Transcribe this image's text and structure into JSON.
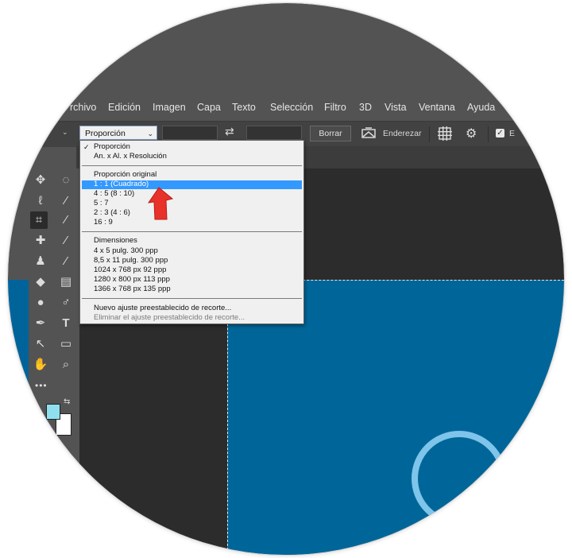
{
  "menu": {
    "items": [
      "rchivo",
      "Edición",
      "Imagen",
      "Capa",
      "Texto",
      "Selección",
      "Filtro",
      "3D",
      "Vista",
      "Ventana",
      "Ayuda"
    ]
  },
  "options_bar": {
    "ratio_select_value": "Proporción",
    "swap_icon": "swap-arrows-icon",
    "clear_button": "Borrar",
    "straighten_label": "Enderezar",
    "overlay_icon": "grid-overlay-icon",
    "settings_icon": "gear-icon",
    "checkbox_checked": true,
    "truncated_label": "E"
  },
  "dropdown": {
    "group1": [
      {
        "label": "Proporción",
        "checked": true
      },
      {
        "label": "An. x Al. x Resolución",
        "checked": false
      }
    ],
    "group2_header": "Proporción original",
    "group2": [
      {
        "label": "1 : 1 (Cuadrado)",
        "highlighted": true
      },
      {
        "label": "4 : 5 (8 : 10)"
      },
      {
        "label": "5 : 7"
      },
      {
        "label": "2 : 3 (4 : 6)"
      },
      {
        "label": "16 : 9"
      }
    ],
    "group3_header": "Dimensiones",
    "group3": [
      "4 x 5 pulg.  300 ppp",
      "8,5 x 11 pulg.  300 ppp",
      "1024 x 768 px  92 ppp",
      "1280 x 800 px  113 ppp",
      "1366 x 768 px  135 ppp"
    ],
    "group4": [
      {
        "label": "Nuevo ajuste preestablecido de recorte...",
        "disabled": false
      },
      {
        "label": "Eliminar el ajuste preestablecido de recorte...",
        "disabled": true
      }
    ]
  },
  "tools": [
    "move-tool-icon",
    "marquee-tool-icon",
    "lasso-tool-icon",
    "magic-wand-icon",
    "crop-tool-icon",
    "eyedropper-icon",
    "healing-brush-icon",
    "brush-icon",
    "clone-stamp-icon",
    "history-brush-icon",
    "eraser-icon",
    "gradient-icon",
    "blur-icon",
    "dodge-icon",
    "pen-tool-icon",
    "type-tool-icon",
    "path-selection-icon",
    "rectangle-tool-icon",
    "hand-tool-icon",
    "zoom-tool-icon"
  ],
  "colors": {
    "ui_dark": "#535353",
    "canvas_blue": "#006699",
    "ring_light_blue": "#7fc4ea",
    "highlight": "#3399ff",
    "annotation_arrow": "#e8312a",
    "foreground_swatch": "#8fe0ee",
    "background_swatch": "#ffffff"
  }
}
